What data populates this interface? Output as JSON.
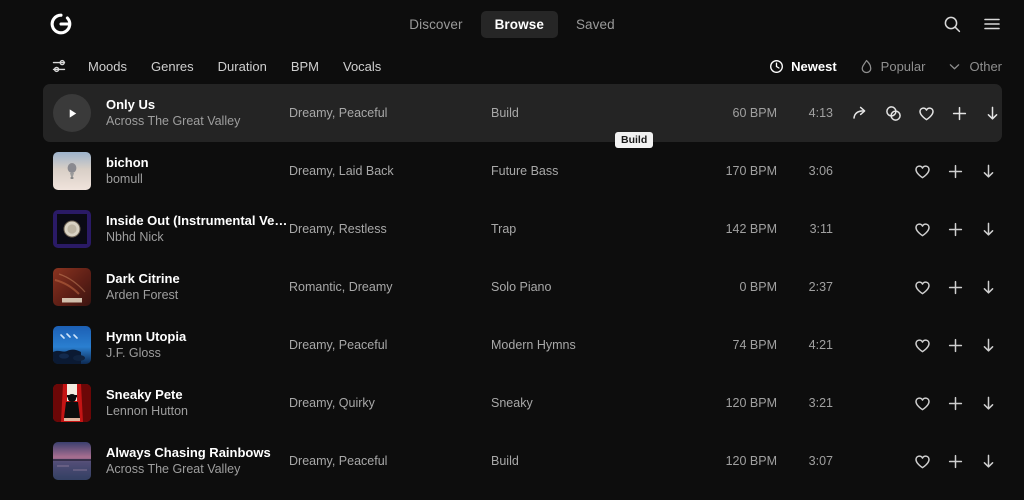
{
  "app": {
    "logo_icon": "circular-e-logo",
    "accent_bg": "#0d0d0d",
    "active_row_bg": "#242424"
  },
  "header": {
    "tabs": [
      {
        "label": "Discover",
        "active": false
      },
      {
        "label": "Browse",
        "active": true
      },
      {
        "label": "Saved",
        "active": false
      }
    ],
    "search_icon": "search-icon",
    "menu_icon": "hamburger-menu-icon"
  },
  "filters": {
    "filter_icon": "sliders-filter-icon",
    "items": [
      "Moods",
      "Genres",
      "Duration",
      "BPM",
      "Vocals"
    ],
    "sorts": [
      {
        "label": "Newest",
        "icon": "clock-icon",
        "active": true
      },
      {
        "label": "Popular",
        "icon": "flame-icon",
        "active": false
      },
      {
        "label": "Other",
        "icon": "chevron-down-icon",
        "active": false
      }
    ]
  },
  "tooltip": {
    "text": "Build"
  },
  "tracks": [
    {
      "title": "Only Us",
      "artist": "Across The Great Valley",
      "moods": "Dreamy, Peaceful",
      "genre": "Build",
      "bpm": "60 BPM",
      "duration": "4:13",
      "active": true,
      "art": "play-button"
    },
    {
      "title": "bichon",
      "artist": "bomull",
      "moods": "Dreamy, Laid Back",
      "genre": "Future Bass",
      "bpm": "170 BPM",
      "duration": "3:06",
      "active": false,
      "art": "balloon-pale-sky"
    },
    {
      "title": "Inside Out (Instrumental Version)",
      "artist": "Nbhd Nick",
      "moods": "Dreamy, Restless",
      "genre": "Trap",
      "bpm": "142 BPM",
      "duration": "3:11",
      "active": false,
      "art": "coin-dark-blue"
    },
    {
      "title": "Dark Citrine",
      "artist": "Arden Forest",
      "moods": "Romantic, Dreamy",
      "genre": "Solo Piano",
      "bpm": "0 BPM",
      "duration": "2:37",
      "active": false,
      "art": "red-brown-abstract"
    },
    {
      "title": "Hymn Utopia",
      "artist": "J.F. Gloss",
      "moods": "Dreamy, Peaceful",
      "genre": "Modern Hymns",
      "bpm": "74 BPM",
      "duration": "4:21",
      "active": false,
      "art": "blue-sky-rocks"
    },
    {
      "title": "Sneaky Pete",
      "artist": "Lennon Hutton",
      "moods": "Dreamy, Quirky",
      "genre": "Sneaky",
      "bpm": "120 BPM",
      "duration": "3:21",
      "active": false,
      "art": "red-curtain-silhouette"
    },
    {
      "title": "Always Chasing Rainbows",
      "artist": "Across The Great Valley",
      "moods": "Dreamy, Peaceful",
      "genre": "Build",
      "bpm": "120 BPM",
      "duration": "3:07",
      "active": false,
      "art": "purple-lake-sunset"
    }
  ],
  "row_actions": {
    "share": "share-arrow-icon",
    "similar": "similar-circles-icon",
    "like": "heart-icon",
    "add": "plus-icon",
    "download": "download-arrow-icon"
  }
}
